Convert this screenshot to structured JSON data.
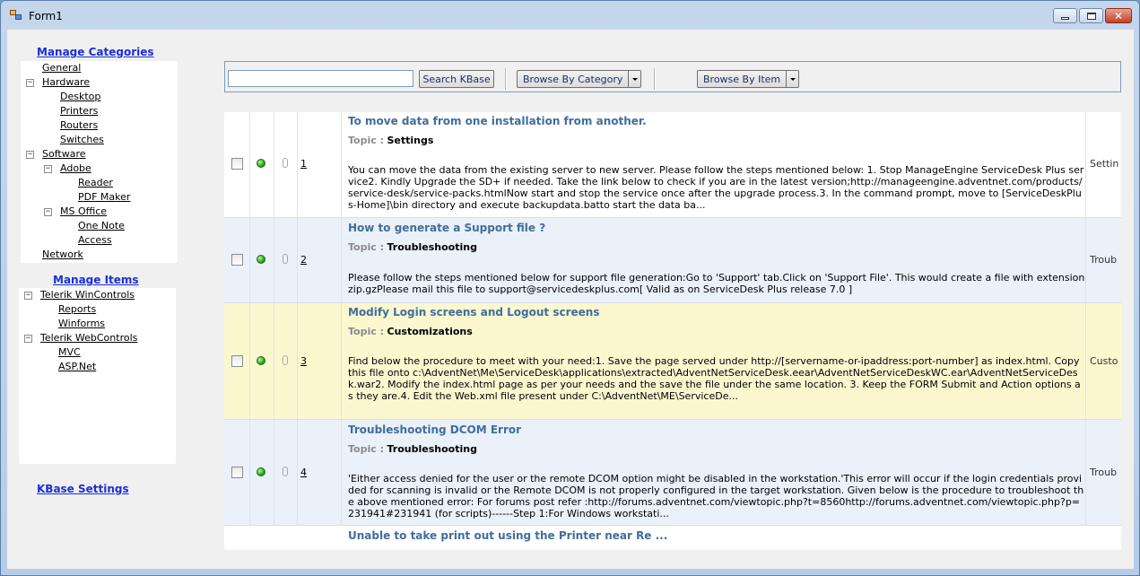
{
  "window": {
    "title": "Form1"
  },
  "sidebar": {
    "manage_categories": "Manage Categories",
    "categories": {
      "general": "General",
      "hardware": "Hardware",
      "desktop": "Desktop",
      "printers": "Printers",
      "routers": "Routers",
      "switches": "Switches",
      "software": "Software",
      "adobe": "Adobe",
      "reader": "Reader",
      "pdf_maker": "PDF Maker",
      "ms_office": "MS Office",
      "one_note": "One Note",
      "access": "Access",
      "network": "Network"
    },
    "manage_items": "Manage Items",
    "items": {
      "telerik_wincontrols": "Telerik WinControls",
      "reports": "Reports",
      "winforms": "Winforms",
      "telerik_webcontrols": "Telerik WebControls",
      "mvc": "MVC",
      "aspnet": "ASP.Net"
    },
    "kbase_settings": "KBase Settings"
  },
  "toolbar": {
    "search_value": "",
    "search_button": "Search KBase",
    "browse_category": "Browse By Category",
    "browse_item": "Browse By Item"
  },
  "grid": {
    "topic_label": "Topic :",
    "rows": [
      {
        "num": "1",
        "title": "To move data from one installation from another.",
        "topic": "Settings",
        "desc": "You can move the data from the existing server to new server. Please follow the steps mentioned below: 1. Stop ManageEngine ServiceDesk Plus service2. Kindly Upgrade the SD+ if needed. Take the link below to check if you are in the latest version;http://manageengine.adventnet.com/products/service-desk/service-packs.htmlNow start and stop the service once after the upgrade process.3. In the command prompt, move to [ServiceDeskPlus-Home]\\bin directory and execute backupdata.batto start the data ba...",
        "category": "Settin"
      },
      {
        "num": "2",
        "title": "How to generate a Support file ?",
        "topic": "Troubleshooting",
        "desc": "Please follow the steps mentioned below for support file generation:Go to 'Support' tab.Click on 'Support File'. This would create a file with extension zip.gzPlease mail this file to support@servicedeskplus.com[ Valid as on ServiceDesk Plus release 7.0 ]",
        "category": "Troub"
      },
      {
        "num": "3",
        "title": "Modify Login screens and Logout screens",
        "topic": "Customizations",
        "desc": "Find below the procedure to meet with your need:1. Save the page served under http://[servername-or-ipaddress:port-number] as index.html. Copy this file onto c:\\AdventNet\\Me\\ServiceDesk\\applications\\extracted\\AdventNetServiceDesk.eear\\AdventNetServiceDeskWC.ear\\AdventNetServiceDesk.war2. Modify the index.html page as per your needs and the save the file under the same location. 3. Keep the FORM Submit and Action options as they are.4. Edit the Web.xml file present under C:\\AdventNet\\ME\\ServiceDe...",
        "category": "Custo"
      },
      {
        "num": "4",
        "title": "Troubleshooting DCOM Error",
        "topic": "Troubleshooting",
        "desc": "'Either access denied for the user or the remote DCOM option might be disabled in the workstation.'This error will occur if the login credentials provided for scanning is invalid or the Remote DCOM is not properly configured in the target workstation. Given below is the procedure to troubleshoot the above mentioned error: For forums post refer :http://forums.adventnet.com/viewtopic.php?t=8560http://forums.adventnet.com/viewtopic.php?p=231941#231941 (for scripts)------Step 1:For Windows workstati...",
        "category": "Troub"
      },
      {
        "title": "Unable to take print out using the Printer near Re ..."
      }
    ]
  },
  "colors": {
    "link_blue": "#1a2fd8",
    "title_blue": "#416d9c",
    "row_alt": "#eaf1f9",
    "row_selected": "#fbf8d0",
    "status_green": "#2ea21c"
  },
  "icons": [
    "app-icon",
    "minimize-icon",
    "maximize-icon",
    "close-icon",
    "expand-collapse-icon",
    "dropdown-arrow-icon",
    "status-icon",
    "attachment-icon"
  ]
}
